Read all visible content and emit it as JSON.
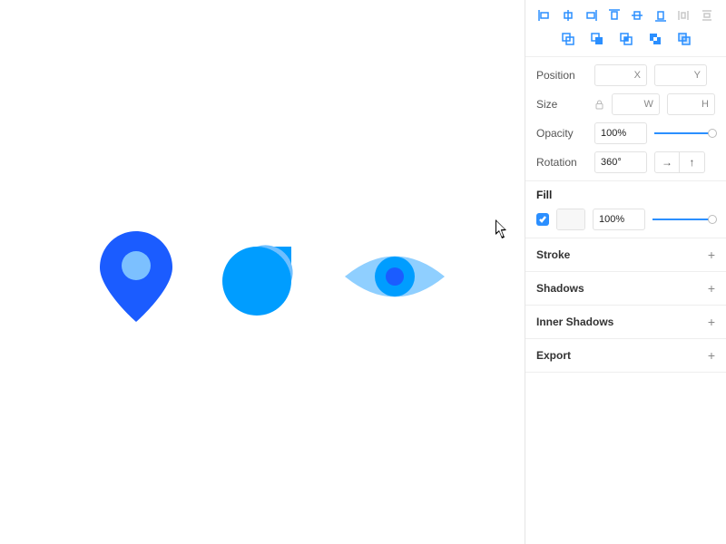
{
  "inspector": {
    "position": {
      "label": "Position",
      "x_placeholder": "X",
      "y_placeholder": "Y"
    },
    "size": {
      "label": "Size",
      "w_placeholder": "W",
      "h_placeholder": "H"
    },
    "opacity": {
      "label": "Opacity",
      "value": "100%"
    },
    "rotation": {
      "label": "Rotation",
      "value": "360°"
    },
    "fill": {
      "label": "Fill",
      "enabled": true,
      "opacity": "100%"
    },
    "sections": {
      "stroke": "Stroke",
      "shadows": "Shadows",
      "inner_shadows": "Inner Shadows",
      "export": "Export"
    }
  },
  "colors": {
    "accent": "#2b8fff",
    "pin_body": "#1b5cff",
    "pin_hole": "#7cc0ff",
    "blob_back": "#009dff",
    "blob_front": "#6fbfff",
    "eye_outer": "#8fcfff",
    "eye_mid": "#009dff",
    "eye_pupil": "#1b5cff"
  }
}
